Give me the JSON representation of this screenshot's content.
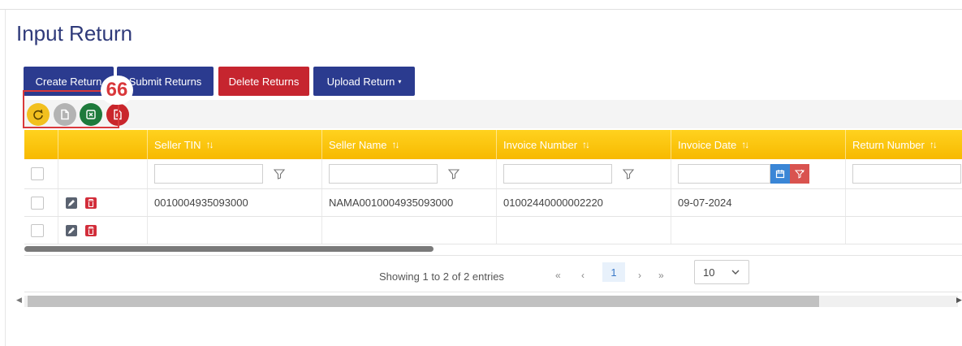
{
  "page": {
    "title": "Input Return"
  },
  "actions": {
    "create": "Create Return",
    "submit": "Submit Returns",
    "delete": "Delete Returns",
    "upload": "Upload Return",
    "upload_caret": "▾"
  },
  "annotation": {
    "badge": "66"
  },
  "toolbar": {
    "icons": [
      "refresh-icon",
      "document-icon",
      "excel-icon",
      "pdf-icon"
    ],
    "colors": {
      "refresh": "#f2c01f",
      "doc": "#b3b3b3",
      "excel": "#1e7a3c",
      "pdf": "#c9262c"
    }
  },
  "table": {
    "columns": [
      "Seller TIN",
      "Seller Name",
      "Invoice Number",
      "Invoice Date",
      "Return Number"
    ],
    "sort_glyph": "↑↓",
    "rows": [
      {
        "seller_tin": "0010004935093000",
        "seller_name": "NAMA0010004935093000",
        "invoice_number": "01002440000002220",
        "invoice_date": "09-07-2024",
        "return_number": ""
      },
      {
        "seller_tin": "",
        "seller_name": "",
        "invoice_number": "",
        "invoice_date": "",
        "return_number": ""
      }
    ],
    "header_color": "#f7b900"
  },
  "pagination": {
    "info": "Showing 1 to 2 of 2 entries",
    "first": "«",
    "prev": "‹",
    "current": "1",
    "next": "›",
    "last": "»",
    "page_size": "10"
  },
  "colors": {
    "primary": "#2b3b8f",
    "danger": "#c6252f",
    "highlight": "#d9383b"
  }
}
